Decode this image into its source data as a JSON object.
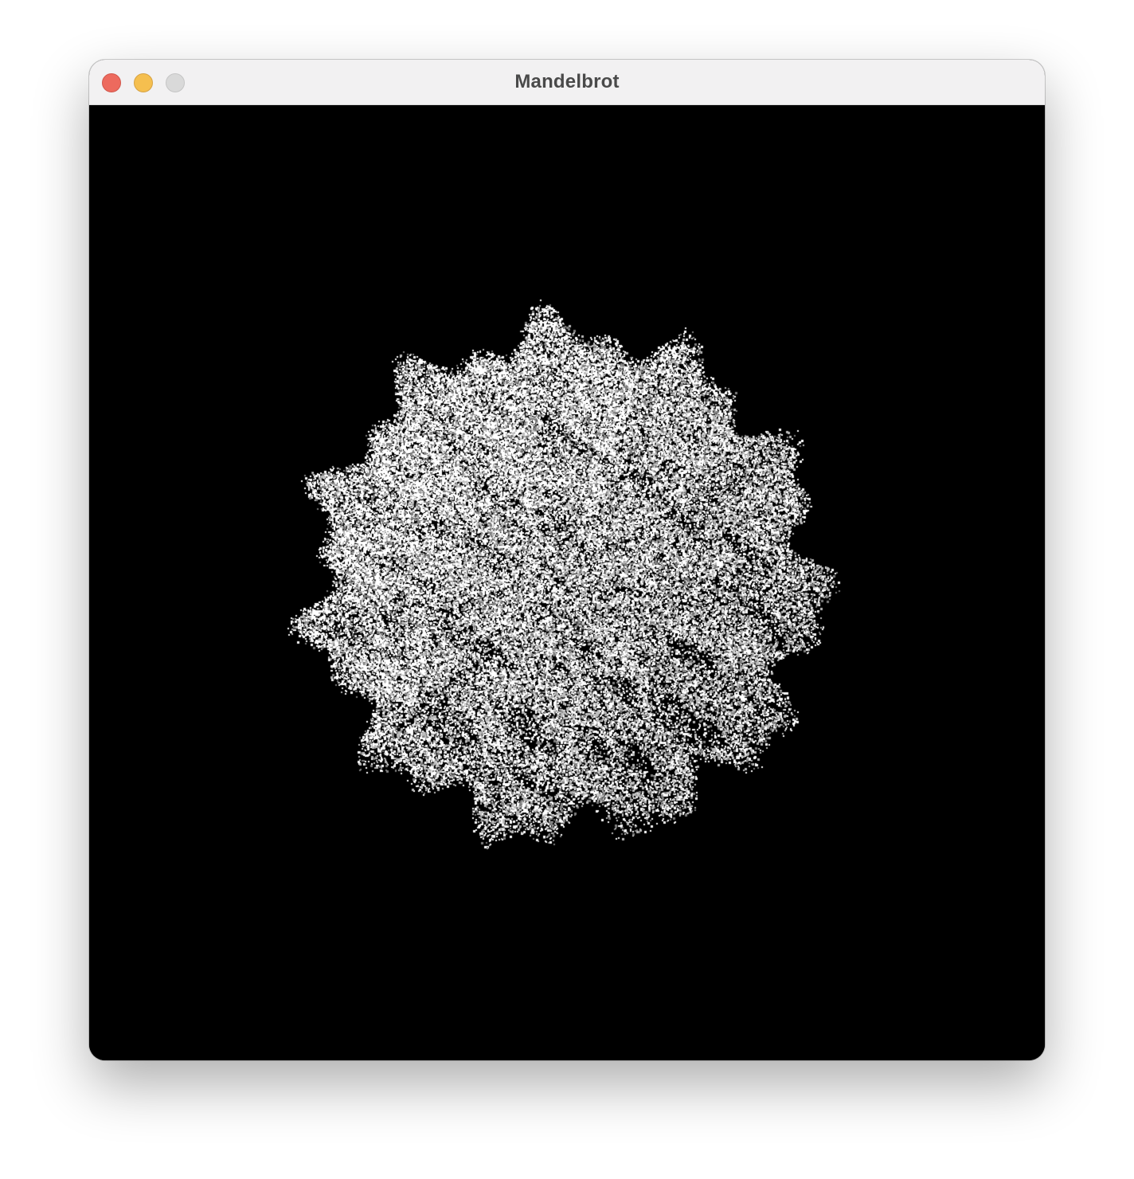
{
  "window": {
    "title": "Mandelbrot",
    "controls": [
      {
        "name": "close-button",
        "color": "#ed6a5e"
      },
      {
        "name": "minimize-button",
        "color": "#f5bf4f"
      },
      {
        "name": "zoom-button",
        "color": "#d9d9d9"
      }
    ]
  },
  "render": {
    "background": "#000000",
    "point_colors": [
      "#ffffff",
      "#bdbdbd",
      "#7f7f7f"
    ]
  }
}
